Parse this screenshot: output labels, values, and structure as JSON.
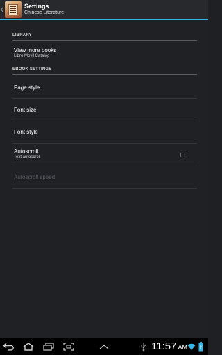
{
  "action_bar": {
    "title": "Settings",
    "subtitle": "Chinese Literature"
  },
  "settings": {
    "library_category": "LIBRARY",
    "view_more_books": {
      "title": "View more books",
      "summary": "Libro Movil Catalog"
    },
    "ebook_category": "EBOOK SETTINGS",
    "page_style": {
      "title": "Page style"
    },
    "font_size": {
      "title": "Font size"
    },
    "font_style": {
      "title": "Font style"
    },
    "autoscroll": {
      "title": "Autoscroll",
      "summary": "Text autoscroll",
      "checked": false
    },
    "autoscroll_speed": {
      "title": "Autoscroll speed",
      "enabled": false
    }
  },
  "system_bar": {
    "time": "11:57",
    "ampm": "AM"
  },
  "colors": {
    "accent": "#33b5e5",
    "background": "#1f2125",
    "system_bar": "#000000"
  },
  "icons": {
    "back": "back-icon",
    "home": "home-icon",
    "recents": "recents-icon",
    "screenshot": "screenshot-icon",
    "menu_up": "chevron-up-icon",
    "usb": "usb-icon",
    "wifi": "wifi-icon",
    "battery": "battery-icon"
  }
}
